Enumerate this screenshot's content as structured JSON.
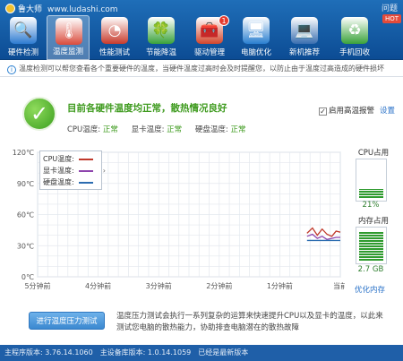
{
  "app": {
    "name": "鲁大师",
    "url": "www.ludashi.com",
    "topright": "问题",
    "badge": "HOT"
  },
  "nav": [
    {
      "label": "硬件检测",
      "icon": "magnifier-icon",
      "glyph": "🔍",
      "color": "#2d7bd1"
    },
    {
      "label": "温度监测",
      "icon": "thermometer-icon",
      "glyph": "🌡",
      "color": "#d94b3c",
      "active": true
    },
    {
      "label": "性能测试",
      "icon": "speedometer-icon",
      "glyph": "◔",
      "color": "#c73b2c"
    },
    {
      "label": "节能降温",
      "icon": "leaf-icon",
      "glyph": "🍀",
      "color": "#3aa23a"
    },
    {
      "label": "驱动管理",
      "icon": "toolbox-icon",
      "glyph": "🧰",
      "color": "#d3462c",
      "badge": "1"
    },
    {
      "label": "电脑优化",
      "icon": "monitor-icon",
      "glyph": "🖥",
      "color": "#2a7fd0"
    },
    {
      "label": "新机推荐",
      "icon": "laptop-icon",
      "glyph": "💻",
      "color": "#3a6fb0"
    },
    {
      "label": "手机回收",
      "icon": "recycle-phone-icon",
      "glyph": "♻",
      "color": "#3aa23a"
    }
  ],
  "notice": "温度检测可以帮您查看各个重要硬件的温度，当硬件温度过高时会及时提醒您，以防止由于温度过高造成的硬件损坏",
  "status": {
    "title": "目前各硬件温度均正常，散热情况良好",
    "cpu_label": "CPU温度:",
    "cpu_value": "正常",
    "gpu_label": "显卡温度:",
    "gpu_value": "正常",
    "disk_label": "硬盘温度:",
    "disk_value": "正常",
    "alarm_label": "启用高温报警",
    "settings": "设置"
  },
  "legend": [
    {
      "label": "CPU温度:",
      "color": "#c0392b"
    },
    {
      "label": "显卡温度:",
      "color": "#8e44ad"
    },
    {
      "label": "硬盘温度:",
      "color": "#2b6cb0"
    }
  ],
  "cpu_panel": {
    "title": "CPU占用",
    "value": "21%",
    "fraction": 0.21
  },
  "mem_panel": {
    "title": "内存占用",
    "value": "2.7 GB",
    "fraction": 0.8
  },
  "optimize": "优化内存",
  "stress_button": "进行温度压力测试",
  "stress_desc": "温度压力测试会执行一系列复杂的运算来快速提升CPU以及显卡的温度，以此来测试您电脑的散热能力，协助排查电脑潜在的散热故障",
  "footer": {
    "main": "主程序版本: 3.76.14.1060",
    "lib": "主设备库版本: 1.0.14.1059",
    "state": "已经是最新版本"
  },
  "chart_data": {
    "type": "line",
    "ylabel": "",
    "xlabel": "",
    "y_ticks": [
      "0℃",
      "30℃",
      "60℃",
      "90℃",
      "120℃"
    ],
    "ylim": [
      0,
      120
    ],
    "x_ticks": [
      "5分钟前",
      "4分钟前",
      "3分钟前",
      "2分钟前",
      "1分钟前",
      "当前"
    ],
    "xlim": [
      -5,
      0
    ],
    "grid": true,
    "series": [
      {
        "name": "CPU温度",
        "color": "#c0392b",
        "x": [
          -0.55,
          -0.46,
          -0.38,
          -0.3,
          -0.22,
          -0.14,
          -0.07,
          0
        ],
        "y": [
          42,
          47,
          40,
          46,
          41,
          39,
          44,
          43
        ]
      },
      {
        "name": "显卡温度",
        "color": "#8e44ad",
        "x": [
          -0.55,
          -0.46,
          -0.38,
          -0.3,
          -0.22,
          -0.14,
          -0.07,
          0
        ],
        "y": [
          39,
          41,
          37,
          39,
          36,
          37,
          38,
          38
        ]
      },
      {
        "name": "硬盘温度",
        "color": "#2b6cb0",
        "x": [
          -0.55,
          -0.46,
          -0.38,
          -0.3,
          -0.22,
          -0.14,
          -0.07,
          0
        ],
        "y": [
          35,
          35,
          35,
          35,
          35,
          35,
          35,
          35
        ]
      }
    ]
  }
}
